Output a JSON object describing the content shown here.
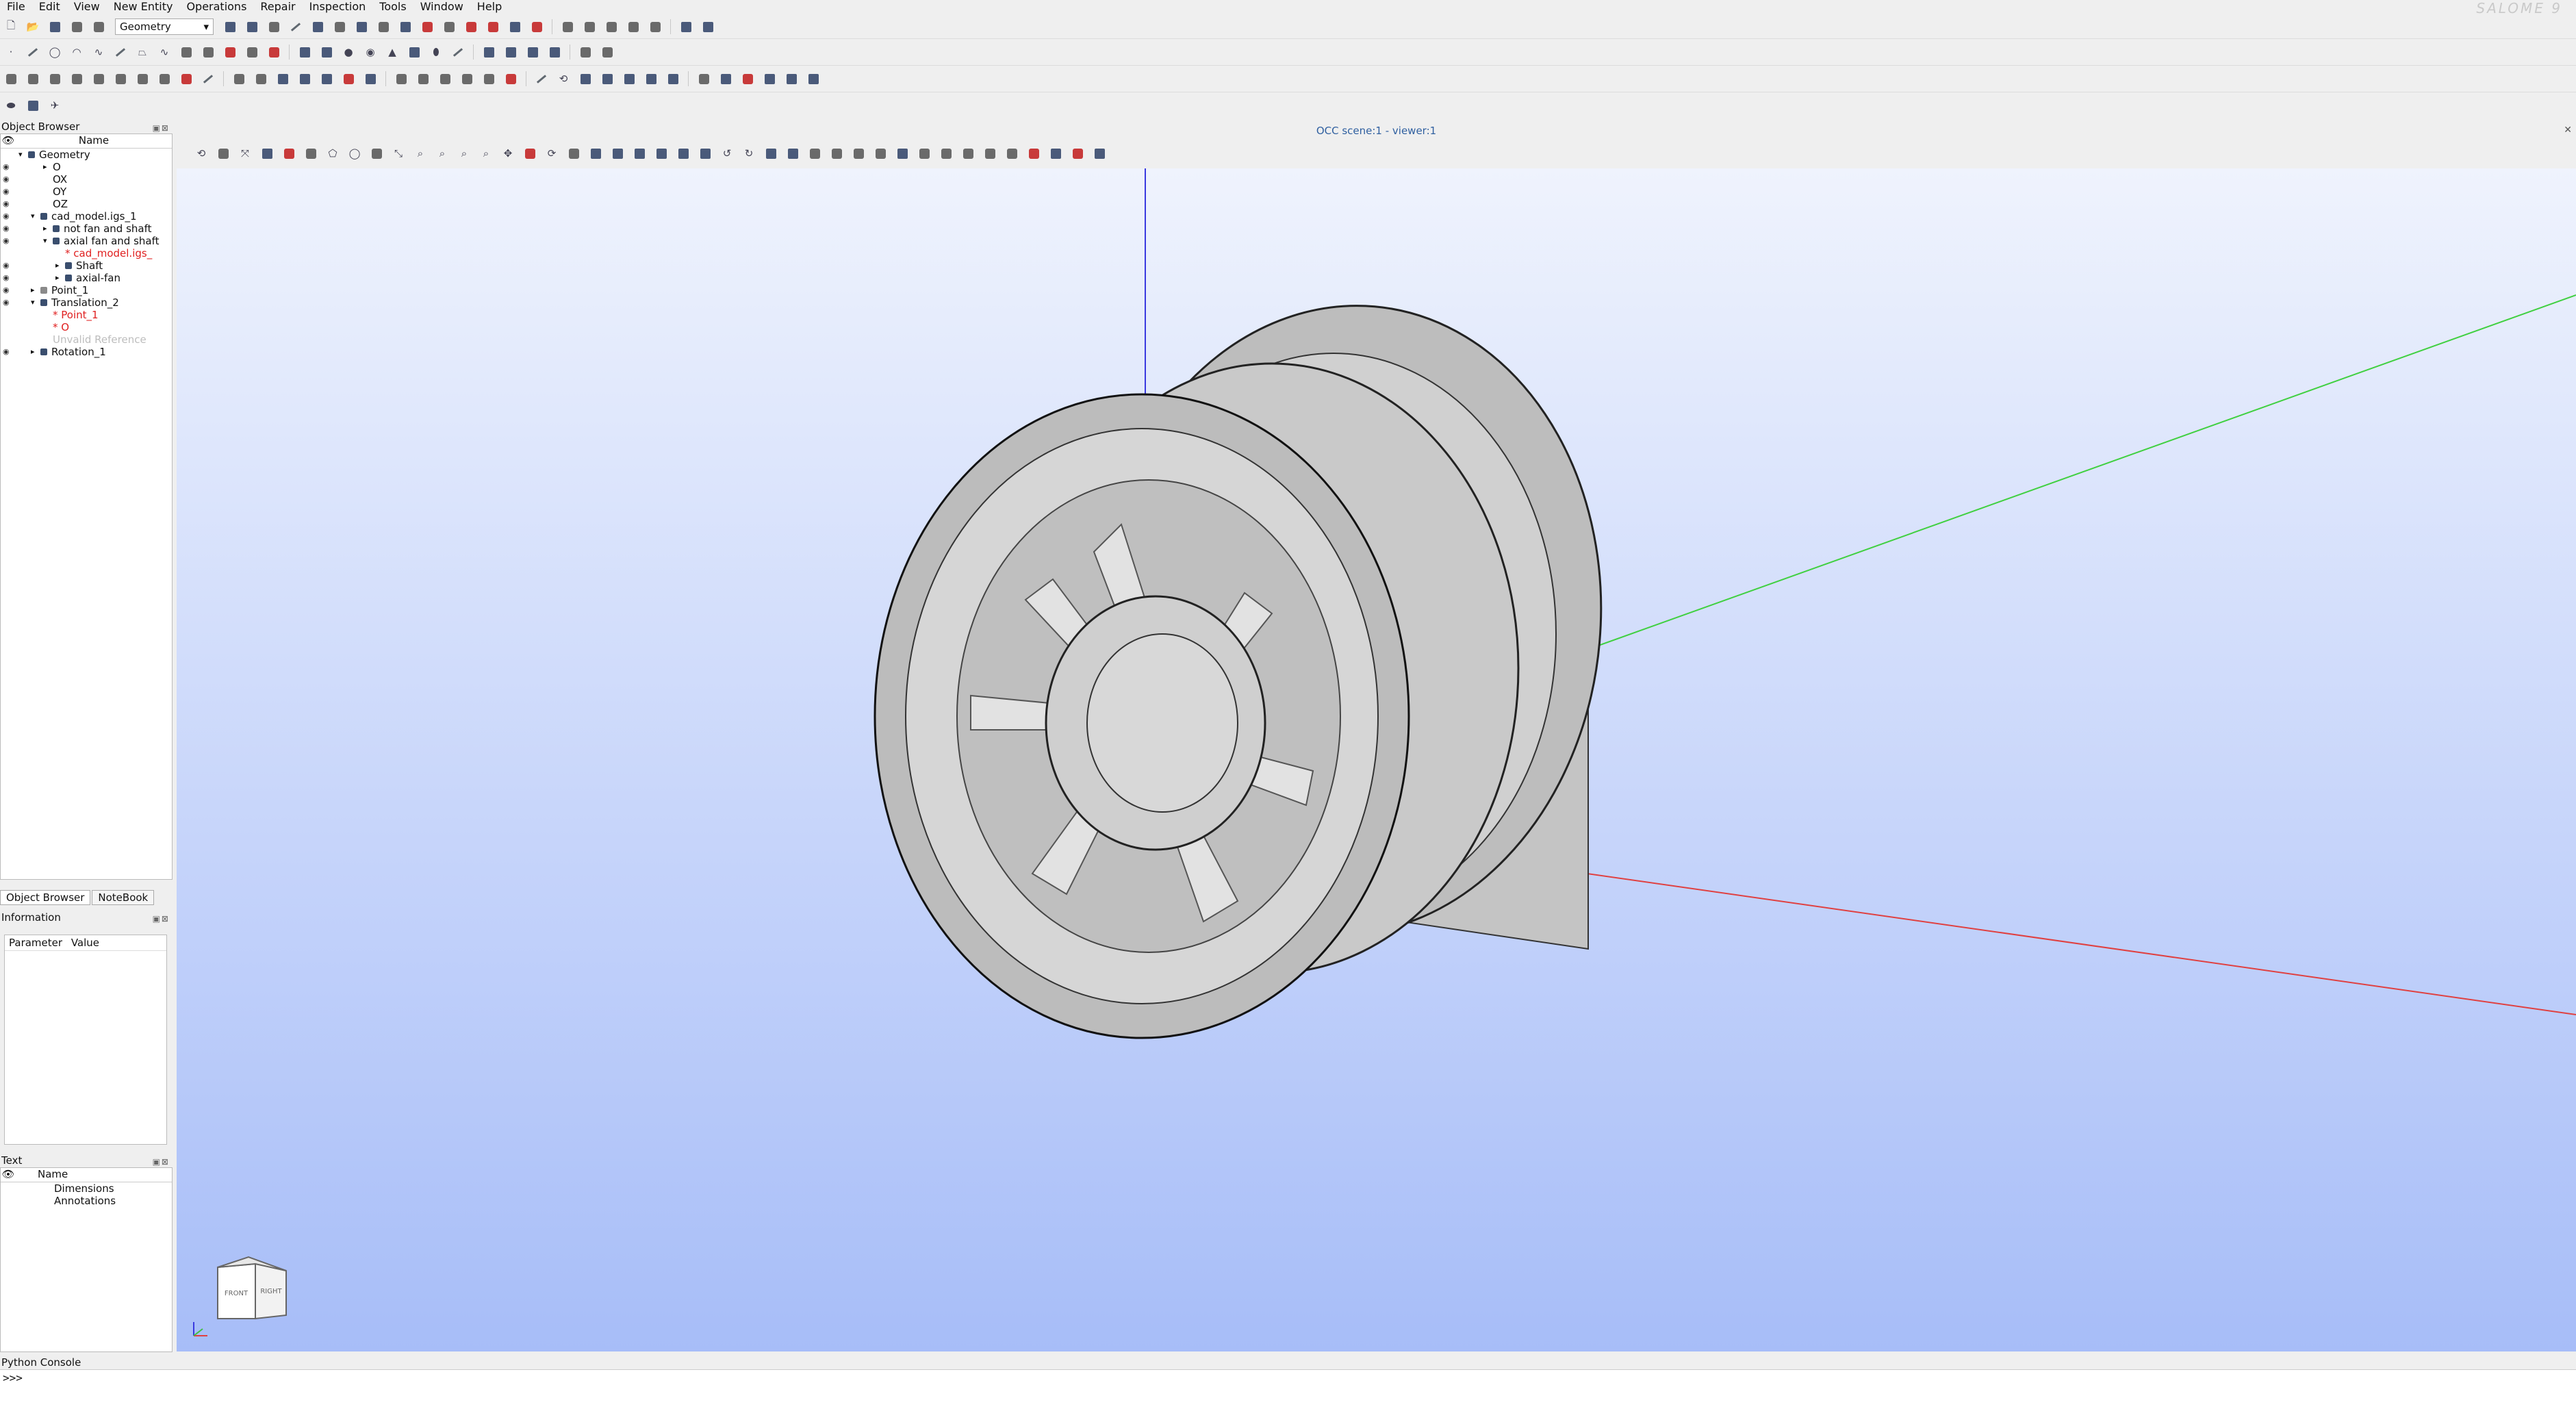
{
  "brand": "SALOME 9",
  "menu": [
    "File",
    "Edit",
    "View",
    "New Entity",
    "Operations",
    "Repair",
    "Inspection",
    "Tools",
    "Window",
    "Help"
  ],
  "module": "Geometry",
  "object_browser": {
    "title": "Object Browser",
    "column": "Name",
    "tree": [
      {
        "label": "Geometry",
        "indent": 0,
        "expander": "▾",
        "icon": "folder-icon",
        "eye": false,
        "cls": ""
      },
      {
        "label": "O",
        "indent": 2,
        "expander": "+",
        "icon": "",
        "eye": true,
        "cls": ""
      },
      {
        "label": "OX",
        "indent": 2,
        "expander": "",
        "icon": "",
        "eye": true,
        "cls": ""
      },
      {
        "label": "OY",
        "indent": 2,
        "expander": "",
        "icon": "",
        "eye": true,
        "cls": ""
      },
      {
        "label": "OZ",
        "indent": 2,
        "expander": "",
        "icon": "",
        "eye": true,
        "cls": ""
      },
      {
        "label": "cad_model.igs_1",
        "indent": 1,
        "expander": "▾",
        "icon": "shape-icon",
        "eye": true,
        "cls": ""
      },
      {
        "label": "not fan and shaft",
        "indent": 2,
        "expander": "▸",
        "icon": "shape-icon",
        "eye": true,
        "cls": ""
      },
      {
        "label": "axial fan and shaft",
        "indent": 2,
        "expander": "▾",
        "icon": "shape-icon",
        "eye": true,
        "cls": ""
      },
      {
        "label": "* cad_model.igs_",
        "indent": 3,
        "expander": "",
        "icon": "",
        "eye": false,
        "cls": "red"
      },
      {
        "label": "Shaft",
        "indent": 3,
        "expander": "▸",
        "icon": "shape-icon",
        "eye": true,
        "cls": ""
      },
      {
        "label": "axial-fan",
        "indent": 3,
        "expander": "▸",
        "icon": "shape-icon",
        "eye": true,
        "cls": ""
      },
      {
        "label": "Point_1",
        "indent": 1,
        "expander": "▸",
        "icon": "point-icon",
        "eye": true,
        "cls": ""
      },
      {
        "label": "Translation_2",
        "indent": 1,
        "expander": "▾",
        "icon": "shape-icon",
        "eye": true,
        "cls": ""
      },
      {
        "label": "* Point_1",
        "indent": 2,
        "expander": "",
        "icon": "",
        "eye": false,
        "cls": "red"
      },
      {
        "label": "* O",
        "indent": 2,
        "expander": "",
        "icon": "",
        "eye": false,
        "cls": "red"
      },
      {
        "label": "Unvalid Reference",
        "indent": 2,
        "expander": "",
        "icon": "",
        "eye": false,
        "cls": "grey"
      },
      {
        "label": "Rotation_1",
        "indent": 1,
        "expander": "▸",
        "icon": "shape-icon",
        "eye": true,
        "cls": ""
      }
    ],
    "tabs": [
      "Object Browser",
      "NoteBook"
    ]
  },
  "information": {
    "title": "Information",
    "col1": "Parameter",
    "col2": "Value"
  },
  "text_panel": {
    "title": "Text",
    "column": "Name",
    "items": [
      "Dimensions",
      "Annotations"
    ]
  },
  "viewer": {
    "title": "OCC scene:1 - viewer:1",
    "cube_front": "FRONT",
    "cube_right": "RIGHT"
  },
  "console": {
    "title": "Python Console",
    "prompt": ">>>"
  }
}
